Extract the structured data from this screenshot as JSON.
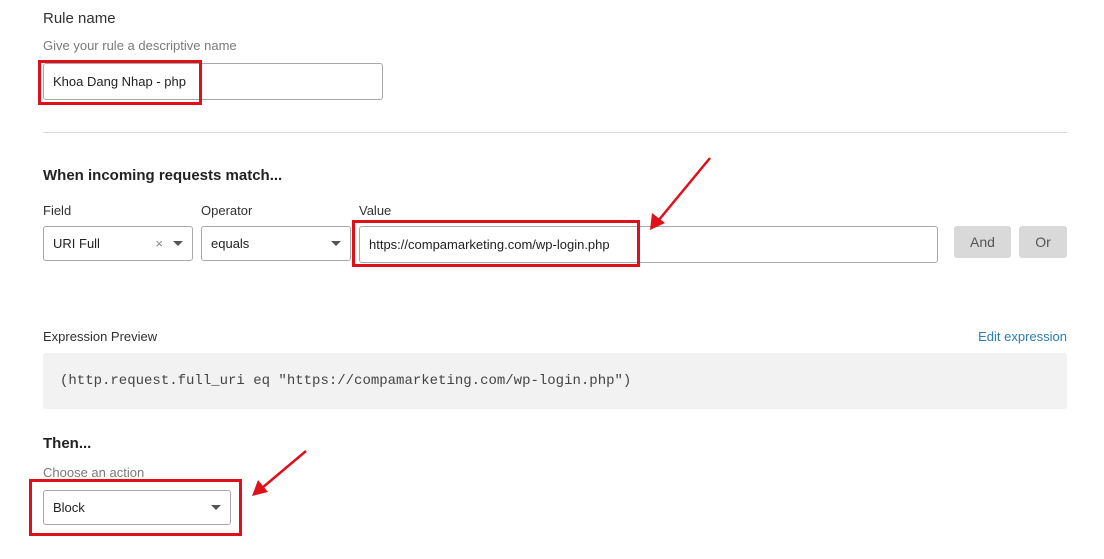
{
  "rule": {
    "title": "Rule name",
    "hint": "Give your rule a descriptive name",
    "value": "Khoa Dang Nhap - php"
  },
  "match": {
    "heading": "When incoming requests match...",
    "field_label": "Field",
    "operator_label": "Operator",
    "value_label": "Value",
    "field_value": "URI Full",
    "field_clear": "×",
    "operator_value": "equals",
    "value_value": "https://compamarketing.com/wp-login.php",
    "and_label": "And",
    "or_label": "Or"
  },
  "expression": {
    "label": "Expression Preview",
    "edit_label": "Edit expression",
    "text": "(http.request.full_uri eq \"https://compamarketing.com/wp-login.php\")"
  },
  "then": {
    "heading": "Then...",
    "hint": "Choose an action",
    "action_value": "Block"
  },
  "colors": {
    "highlight": "#e0101a",
    "link": "#2c7cb0",
    "button_bg": "#d9d9d9"
  }
}
